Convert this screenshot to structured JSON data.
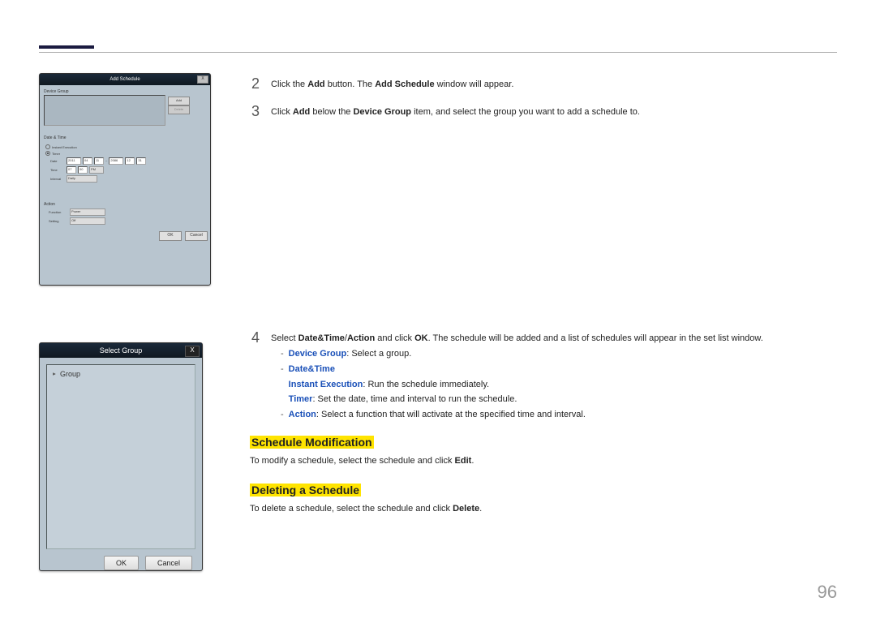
{
  "page_number": "96",
  "win1": {
    "title": "Add Schedule",
    "close": "X",
    "device_group_label": "Device Group",
    "add_btn": "Add",
    "del_btn": "Delete",
    "date_time_label": "Date & Time",
    "instant_label": "Instant Execution",
    "timer_label": "Timer",
    "date_label": "Date",
    "date_y1": "2011",
    "date_m1": "04",
    "date_d1": "11",
    "date_sep": "~",
    "date_y2": "2086",
    "date_m2": "12",
    "date_d2": "31",
    "time_label": "Time",
    "time_h": "07",
    "time_m": "00",
    "time_ampm": "PM",
    "interval_label": "Interval",
    "interval_val": "Daily",
    "action_label": "Action",
    "function_label": "Function",
    "function_val": "Power",
    "setting_label": "Setting",
    "setting_val": "Off",
    "ok_btn": "OK",
    "cancel_btn": "Cancel"
  },
  "win2": {
    "title": "Select Group",
    "close": "X",
    "group_label": "Group",
    "ok_btn": "OK",
    "cancel_btn": "Cancel"
  },
  "steps": {
    "s2": {
      "num": "2",
      "text_a": "Click the ",
      "add": "Add",
      "text_b": " button. The ",
      "add_schedule": "Add Schedule",
      "text_c": " window will appear."
    },
    "s3": {
      "num": "3",
      "text_a": "Click ",
      "add": "Add",
      "text_b": " below the ",
      "device_group": "Device Group",
      "text_c": " item, and select the group you want to add a schedule to."
    },
    "s4": {
      "num": "4",
      "text_a": "Select ",
      "dta": "Date&Time",
      "slash": "/",
      "action": "Action",
      "text_b": " and click ",
      "ok": "OK",
      "text_c": ". The schedule will be added and a list of schedules will appear in the set list window.",
      "sub_device_group_lbl": "Device Group",
      "sub_device_group_txt": ": Select a group.",
      "sub_dt_lbl": "Date&Time",
      "sub_instant_lbl": "Instant Execution",
      "sub_instant_txt": ": Run the schedule immediately.",
      "sub_timer_lbl": "Timer",
      "sub_timer_txt": ": Set the date, time and interval to run the schedule.",
      "sub_action_lbl": "Action",
      "sub_action_txt": ": Select a function that will activate at the specified time and interval."
    }
  },
  "sections": {
    "mod_title": "Schedule Modification",
    "mod_text_a": "To modify a schedule, select the schedule and click ",
    "mod_edit": "Edit",
    "mod_text_b": ".",
    "del_title": "Deleting a Schedule",
    "del_text_a": "To delete a schedule, select the schedule and click ",
    "del_delete": "Delete",
    "del_text_b": "."
  }
}
